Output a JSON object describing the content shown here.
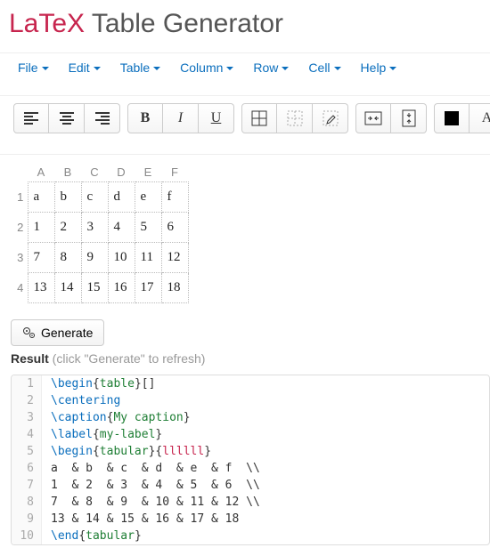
{
  "title": {
    "brand": "LaTeX",
    "rest": " Table Generator"
  },
  "menus": {
    "file": "File",
    "edit": "Edit",
    "table": "Table",
    "column": "Column",
    "row": "Row",
    "cell": "Cell",
    "help": "Help"
  },
  "fmt": {
    "bold": "B",
    "italic": "I",
    "underline": "U",
    "clear_letter": "A"
  },
  "sheet": {
    "columns": [
      "A",
      "B",
      "C",
      "D",
      "E",
      "F"
    ],
    "rows": [
      "1",
      "2",
      "3",
      "4"
    ],
    "cells": [
      [
        "a",
        "b",
        "c",
        "d",
        "e",
        "f"
      ],
      [
        "1",
        "2",
        "3",
        "4",
        "5",
        "6"
      ],
      [
        "7",
        "8",
        "9",
        "10",
        "11",
        "12"
      ],
      [
        "13",
        "14",
        "15",
        "16",
        "17",
        "18"
      ]
    ]
  },
  "generate_label": "Generate",
  "result": {
    "label": "Result",
    "hint": " (click \"Generate\" to refresh)"
  },
  "code": {
    "lines": [
      {
        "cmd": "\\begin",
        "arg": "table",
        "tail": "[]"
      },
      {
        "cmd": "\\centering"
      },
      {
        "cmd": "\\caption",
        "arg": "My caption"
      },
      {
        "cmd": "\\label",
        "arg": "my-label"
      },
      {
        "cmd": "\\begin",
        "arg": "tabular",
        "tail_arg": "llllll"
      },
      {
        "plain": "a  & b  & c  & d  & e  & f  \\\\"
      },
      {
        "plain": "1  & 2  & 3  & 4  & 5  & 6  \\\\"
      },
      {
        "plain": "7  & 8  & 9  & 10 & 11 & 12 \\\\"
      },
      {
        "plain": "13 & 14 & 15 & 16 & 17 & 18"
      },
      {
        "cmd": "\\end",
        "arg": "tabular"
      }
    ]
  }
}
